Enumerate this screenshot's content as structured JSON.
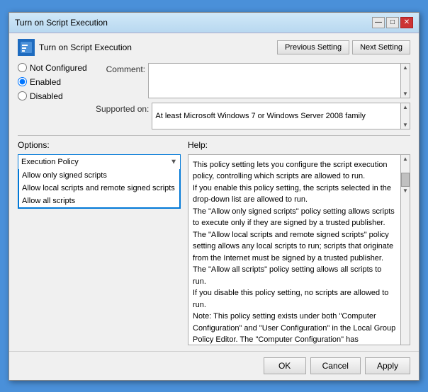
{
  "window": {
    "title": "Turn on Script Execution",
    "controls": {
      "minimize": "—",
      "maximize": "□",
      "close": "✕"
    }
  },
  "header": {
    "title": "Turn on Script Execution",
    "prev_button": "Previous Setting",
    "next_button": "Next Setting"
  },
  "radio_group": {
    "not_configured_label": "Not Configured",
    "enabled_label": "Enabled",
    "disabled_label": "Disabled",
    "selected": "enabled"
  },
  "comment": {
    "label": "Comment:",
    "value": ""
  },
  "supported": {
    "label": "Supported on:",
    "value": "At least Microsoft Windows 7 or Windows Server 2008 family"
  },
  "options": {
    "label": "Options:",
    "dropdown_label": "Execution Policy",
    "items": [
      "Allow only signed scripts",
      "Allow local scripts and remote signed scripts",
      "Allow all scripts"
    ]
  },
  "help": {
    "label": "Help:",
    "paragraphs": [
      "This policy setting lets you configure the script execution policy, controlling which scripts are allowed to run.",
      "If you enable this policy setting, the scripts selected in the drop-down list are allowed to run.",
      "The \"Allow only signed scripts\" policy setting allows scripts to execute only if they are signed by a trusted publisher.",
      "The \"Allow local scripts and remote signed scripts\" policy setting allows any local scripts to run; scripts that originate from the Internet must be signed by a trusted publisher.",
      "The \"Allow all scripts\" policy setting allows all scripts to run.",
      "If you disable this policy setting, no scripts are allowed to run.",
      "Note: This policy setting exists under both \"Computer Configuration\" and \"User Configuration\" in the Local Group Policy Editor. The \"Computer Configuration\" has precedence over \"User Configuration.\""
    ]
  },
  "footer": {
    "ok_label": "OK",
    "cancel_label": "Cancel",
    "apply_label": "Apply"
  }
}
